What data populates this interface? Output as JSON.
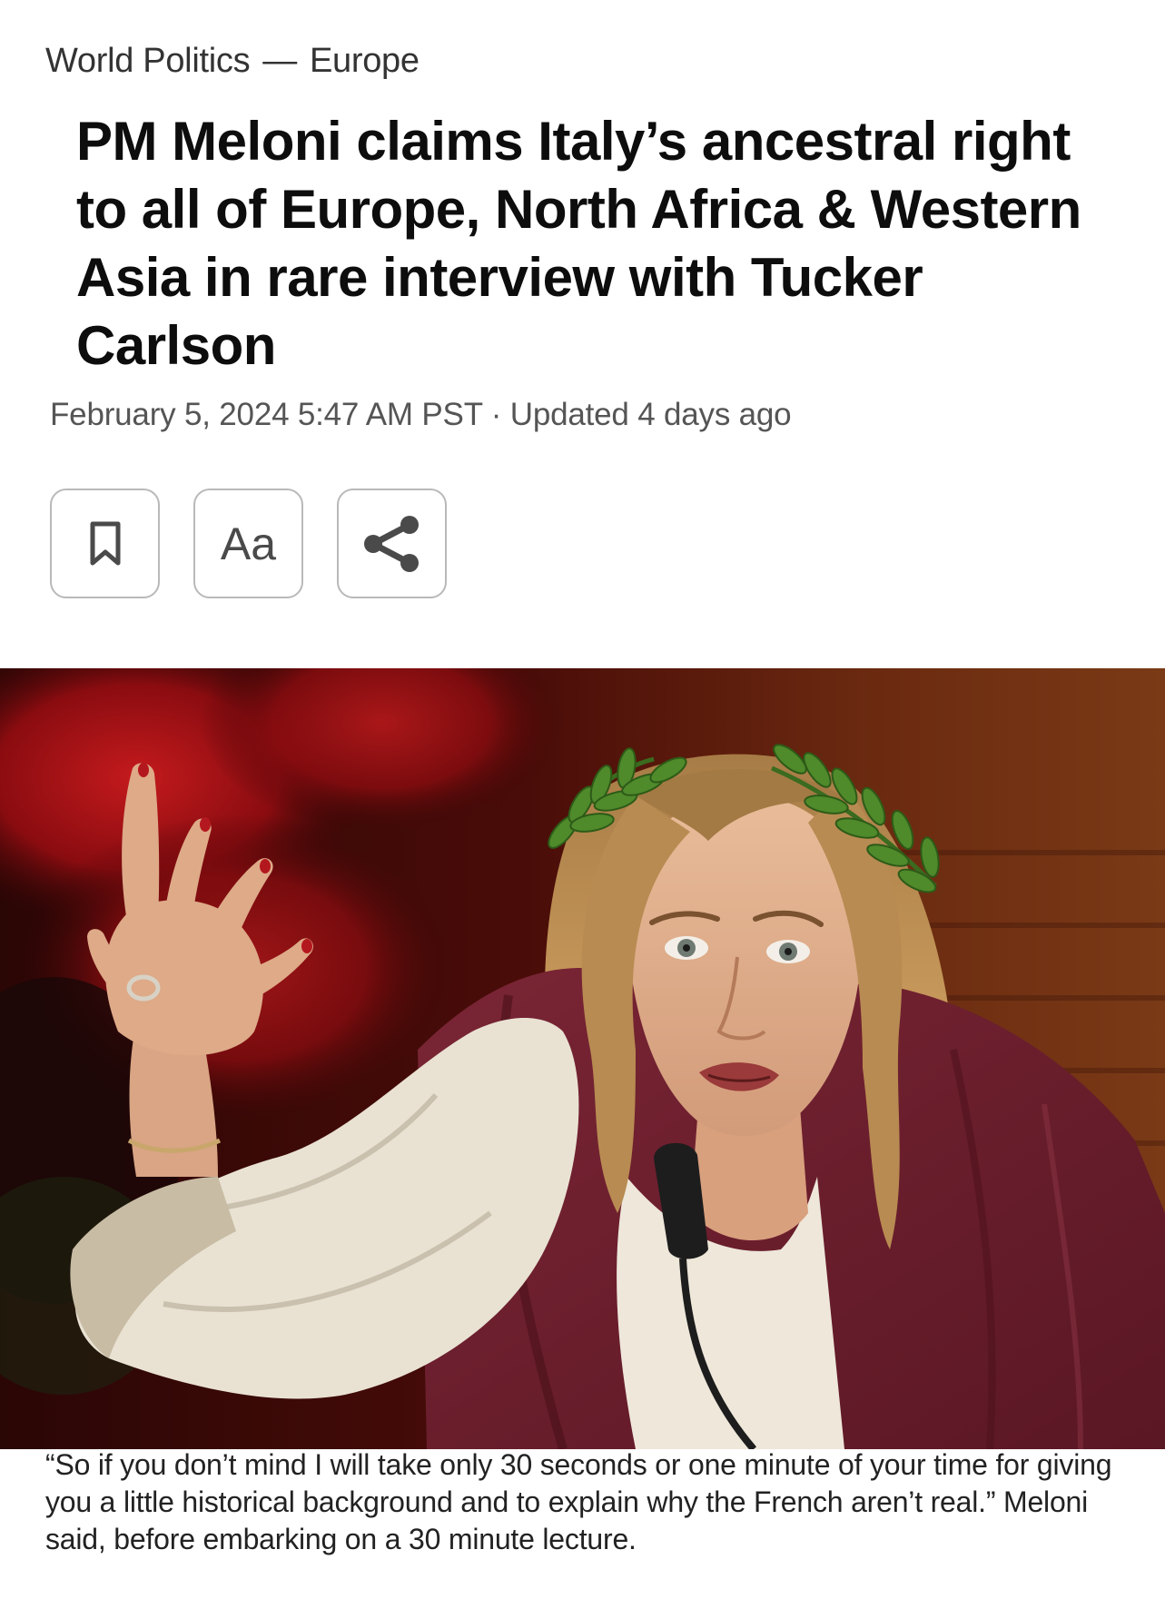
{
  "breadcrumb": {
    "section": "World Politics",
    "separator": "—",
    "subsection": "Europe"
  },
  "article": {
    "headline": "PM Meloni claims Italy’s ancestral right to all of Europe, North Africa & Western Asia in rare interview with Tucker Carlson",
    "dateline": "February 5, 2024 5:47 AM PST · Updated 4 days ago"
  },
  "toolbar": {
    "bookmark_icon": "bookmark-icon",
    "text_size_label": "Aa",
    "share_icon": "share-icon"
  },
  "colors": {
    "backdrop_red": "#8e0f12",
    "toga_maroon": "#6e1f2e",
    "tunic_white": "#eee7da",
    "laurel_green": "#4f8a2b",
    "hair_blonde": "#b98a4e"
  },
  "caption": "“So if you don’t mind I will take only 30 seconds or one minute of your time for giving you a little historical background and to explain why the French aren’t real.” Meloni said, before embarking on a 30 minute lecture."
}
